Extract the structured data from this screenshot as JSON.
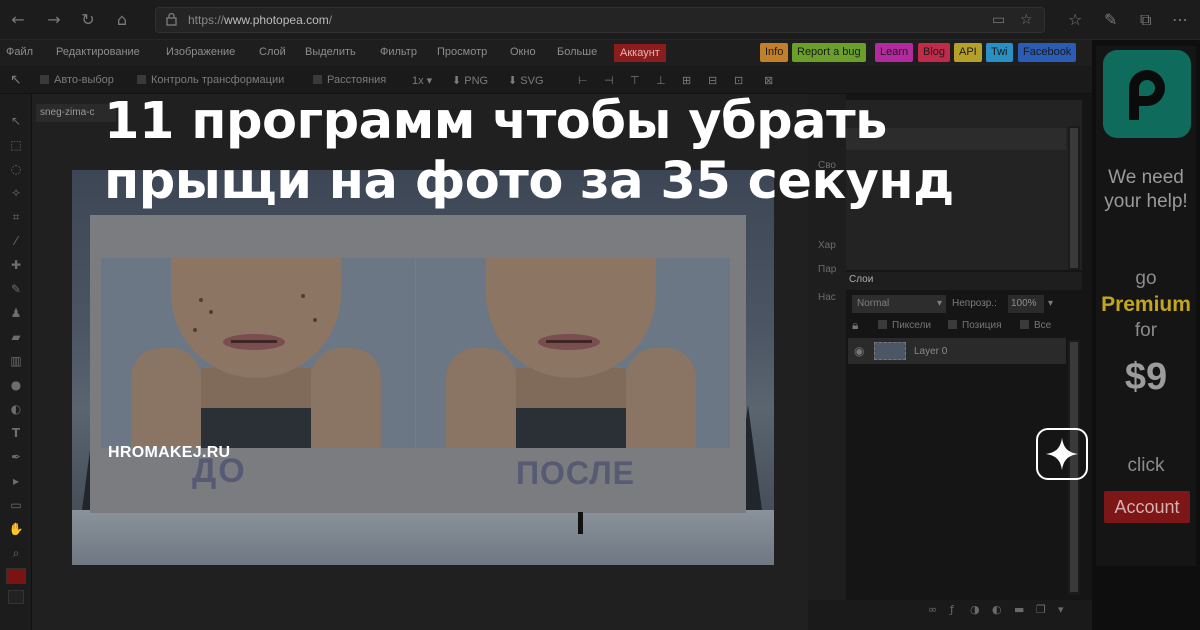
{
  "browser": {
    "url_prefix": "https://",
    "url_host": "www.photopea.com",
    "url_suffix": "/"
  },
  "menu": {
    "items": [
      "Файл",
      "Редактирование",
      "Изображение",
      "Слой",
      "Выделить",
      "Фильтр",
      "Просмотр",
      "Окно",
      "Больше"
    ],
    "account": "Аккаунт",
    "links": [
      {
        "label": "Info",
        "color": "#c2802a"
      },
      {
        "label": "Report a bug",
        "color": "#6aa02a"
      },
      {
        "label": "Learn",
        "color": "#b22a9e"
      },
      {
        "label": "Blog",
        "color": "#c22a4a"
      },
      {
        "label": "API",
        "color": "#b5a02a"
      },
      {
        "label": "Twi",
        "color": "#2a8fc2"
      },
      {
        "label": "Facebook",
        "color": "#2a5bb5"
      }
    ]
  },
  "options": {
    "auto_select": "Авто-выбор",
    "transform": "Контроль трансформации",
    "distances": "Расстояния",
    "zoom": "1x",
    "png": "PNG",
    "svg": "SVG"
  },
  "document": {
    "tab": "sneg-zima-c",
    "label_before": "ДО",
    "label_after": "ПОСЛЕ"
  },
  "panels": {
    "strip": [
      "Сво",
      "Хар",
      "Пар",
      "Нас"
    ],
    "layers_tab": "Слои",
    "blend_mode": "Normal",
    "opacity_label": "Непрозр.:",
    "opacity_value": "100%",
    "lock_pixels": "Пиксели",
    "lock_position": "Позиция",
    "lock_all": "Все",
    "layer_name": "Layer 0"
  },
  "ad": {
    "line1": "We need",
    "line2": "your help!",
    "go": "go",
    "premium": "Premium",
    "for": "for",
    "price": "$9",
    "click": "click",
    "button": "Account"
  },
  "overlay": {
    "headline_line1": "11 программ чтобы убрать",
    "headline_line2": "прыщи на фото за 35 секунд",
    "source": "HROMAKEJ.RU"
  },
  "colors": {
    "accent_red": "#8c1d1d",
    "brand_teal": "#0f6b5b",
    "premium_yellow": "#c2a61e"
  }
}
